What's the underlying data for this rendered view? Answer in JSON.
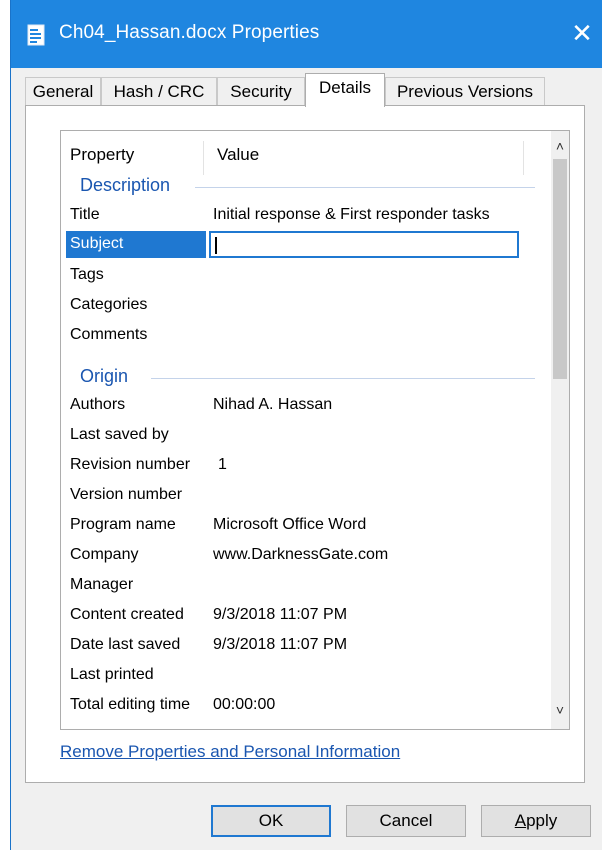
{
  "window": {
    "title": "Ch04_Hassan.docx Properties",
    "close_glyph": "✕"
  },
  "tabs": [
    {
      "label": "General"
    },
    {
      "label": "Hash / CRC"
    },
    {
      "label": "Security"
    },
    {
      "label": "Details"
    },
    {
      "label": "Previous Versions"
    }
  ],
  "active_tab": "Details",
  "list": {
    "header_property": "Property",
    "header_value": "Value",
    "groups": {
      "description": "Description",
      "origin": "Origin"
    },
    "rows": [
      {
        "name": "Title",
        "value": "Initial response & First responder tasks"
      },
      {
        "name": "Subject",
        "value": ""
      },
      {
        "name": "Tags",
        "value": ""
      },
      {
        "name": "Categories",
        "value": ""
      },
      {
        "name": "Comments",
        "value": ""
      },
      {
        "name": "Authors",
        "value": "Nihad A. Hassan"
      },
      {
        "name": "Last saved by",
        "value": ""
      },
      {
        "name": "Revision number",
        "value": "1"
      },
      {
        "name": "Version number",
        "value": ""
      },
      {
        "name": "Program name",
        "value": "Microsoft Office Word"
      },
      {
        "name": "Company",
        "value": "www.DarknessGate.com"
      },
      {
        "name": "Manager",
        "value": ""
      },
      {
        "name": "Content created",
        "value": "9/3/2018 11:07 PM"
      },
      {
        "name": "Date last saved",
        "value": "9/3/2018 11:07 PM"
      },
      {
        "name": "Last printed",
        "value": ""
      },
      {
        "name": "Total editing time",
        "value": "00:00:00"
      }
    ],
    "selected_row": "Subject",
    "scroll_up_glyph": "˄",
    "scroll_down_glyph": "˅"
  },
  "link_text": "Remove Properties and Personal Information",
  "buttons": {
    "ok": "OK",
    "cancel": "Cancel",
    "apply_first": "A",
    "apply_rest": "pply"
  },
  "colors": {
    "titlebar": "#1f86e0",
    "selection": "#1f78d1",
    "link": "#1a56b0",
    "window_bg": "#f0f0f0"
  },
  "icons": {
    "document": "document-icon",
    "close": "close-icon"
  }
}
